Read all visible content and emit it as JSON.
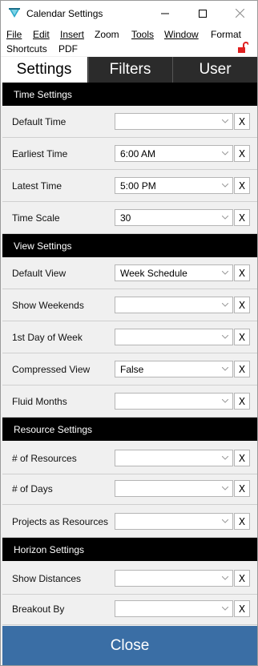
{
  "window": {
    "title": "Calendar Settings"
  },
  "menu": {
    "items": [
      {
        "label": "File"
      },
      {
        "label": "Edit"
      },
      {
        "label": "Insert"
      },
      {
        "label": "Zoom"
      },
      {
        "label": "Tools"
      },
      {
        "label": "Window"
      },
      {
        "label": "Format"
      },
      {
        "label": "Shortcuts"
      },
      {
        "label": "PDF"
      }
    ]
  },
  "tabs": [
    {
      "label": "Settings",
      "active": true
    },
    {
      "label": "Filters",
      "active": false
    },
    {
      "label": "User",
      "active": false
    }
  ],
  "sections": {
    "time": {
      "title": "Time Settings",
      "rows": [
        {
          "label": "Default Time",
          "value": ""
        },
        {
          "label": "Earliest Time",
          "value": "6:00 AM"
        },
        {
          "label": "Latest Time",
          "value": "5:00 PM"
        },
        {
          "label": "Time Scale",
          "value": "30"
        }
      ]
    },
    "view": {
      "title": "View Settings",
      "rows": [
        {
          "label": "Default View",
          "value": "Week Schedule"
        },
        {
          "label": "Show Weekends",
          "value": ""
        },
        {
          "label": "1st Day of Week",
          "value": ""
        },
        {
          "label": "Compressed View",
          "value": "False"
        },
        {
          "label": "Fluid Months",
          "value": ""
        }
      ]
    },
    "resource": {
      "title": "Resource Settings",
      "rows": [
        {
          "label": "# of Resources",
          "value": ""
        },
        {
          "label": "# of Days",
          "value": ""
        },
        {
          "label": "Projects as Resources",
          "value": ""
        }
      ]
    },
    "horizon": {
      "title": "Horizon Settings",
      "rows": [
        {
          "label": "Show Distances",
          "value": ""
        },
        {
          "label": "Breakout By",
          "value": ""
        }
      ]
    }
  },
  "clear_label": "X",
  "close_label": "Close",
  "colors": {
    "accent": "#3a6ea5",
    "header": "#000000",
    "tab_inactive": "#2b2b2b",
    "lock": "#e02020"
  },
  "icons": {
    "app": "calendar-app-icon",
    "lock": "unlocked-padlock-icon",
    "dropdown": "chevron-down-icon"
  }
}
